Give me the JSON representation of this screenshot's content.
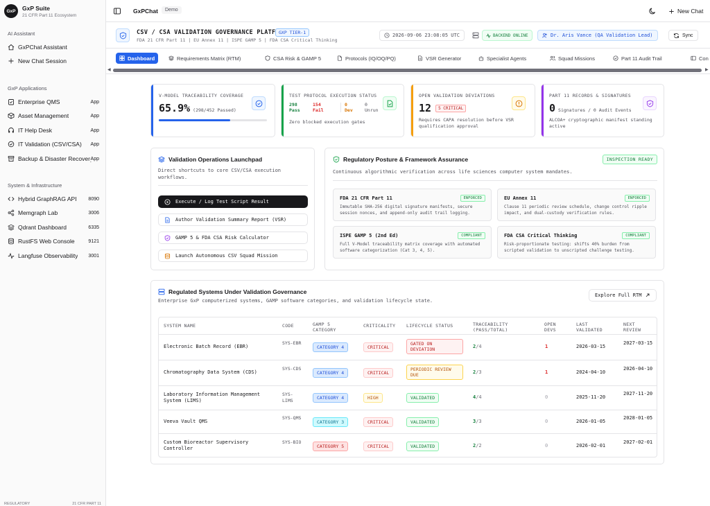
{
  "sidebar": {
    "brand": {
      "logo": "GxP",
      "name": "GxP Suite",
      "subtitle": "21 CFR Part 11 Ecosystem"
    },
    "sections": {
      "ai": "AI Assistant",
      "apps": "GxP Applications",
      "infra": "System & Infrastructure"
    },
    "ai_items": [
      {
        "label": "GxPChat Assistant",
        "icon": "chat-bubble-icon"
      },
      {
        "label": "New Chat Session",
        "icon": "plus-icon"
      }
    ],
    "app_items": [
      {
        "label": "Enterprise QMS",
        "badge": "App"
      },
      {
        "label": "Asset Management",
        "badge": "App"
      },
      {
        "label": "IT Help Desk",
        "badge": "App"
      },
      {
        "label": "IT Validation (CSV/CSA)",
        "badge": "App"
      },
      {
        "label": "Backup & Disaster Recovery",
        "badge": "App"
      }
    ],
    "infra_items": [
      {
        "label": "Hybrid GraphRAG API",
        "badge": "8090"
      },
      {
        "label": "Memgraph Lab",
        "badge": "3006"
      },
      {
        "label": "Qdrant Dashboard",
        "badge": "6335"
      },
      {
        "label": "RustFS Web Console",
        "badge": "9121"
      },
      {
        "label": "Langfuse Observability",
        "badge": "3001"
      }
    ],
    "footer": {
      "left": "REGULATORY",
      "right": "21 CFR PART 11"
    }
  },
  "topbar": {
    "title": "GxPChat",
    "demo": "Demo",
    "new_chat": "New Chat"
  },
  "header": {
    "title": "CSV / CSA VALIDATION GOVERNANCE PLATFORM",
    "tier": "GXP TIER-1",
    "subtitle": "FDA 21 CFR Part 11 | EU Annex 11 | ISPE GAMP 5 | FDA CSA Critical Thinking",
    "timestamp": "2026-09-06 23:08:05 UTC",
    "backend": "BACKEND ONLINE",
    "user": "Dr. Aris Vance (QA Validation Lead)",
    "sync": "Sync"
  },
  "tabs": [
    "Dashboard",
    "Requirements Matrix (RTM)",
    "CSA Risk & GAMP 5",
    "Protocols (IQ/OQ/PQ)",
    "VSR Generator",
    "Specialist Agents",
    "Squad Missions",
    "Part 11 Audit Trail",
    "Con"
  ],
  "kpis": {
    "trace": {
      "title": "V-MODEL TRACEABILITY COVERAGE",
      "value": "65.9%",
      "detail": "(298/452 Passed)",
      "progress": 0.659
    },
    "exec": {
      "title": "TEST PROTOCOL EXECUTION STATUS",
      "pass_n": "298",
      "pass_l": "Pass",
      "fail_n": "154",
      "fail_l": "Fail",
      "dev_n": "0",
      "dev_l": "Dev",
      "unrun_n": "0",
      "unrun_l": "Unrun",
      "note": "Zero blocked execution gates"
    },
    "dev": {
      "title": "OPEN VALIDATION DEVIATIONS",
      "value": "12",
      "badge": "5 CRITICAL",
      "note": "Requires CAPA resolution before VSR qualification approval"
    },
    "part11": {
      "title": "PART 11 RECORDS & SIGNATURES",
      "value": "0",
      "detail": "Signatures / 0 Audit Events",
      "note": "ALCOA+ cryptographic manifest standing active"
    }
  },
  "launchpad": {
    "title": "Validation Operations Launchpad",
    "subtitle": "Direct shortcuts to core CSV/CSA execution workflows.",
    "buttons": [
      "Execute / Log Test Script Result",
      "Author Validation Summary Report (VSR)",
      "GAMP 5 & FDA CSA Risk Calculator",
      "Launch Autonomous CSV Squad Mission"
    ]
  },
  "posture": {
    "title": "Regulatory Posture & Framework Assurance",
    "badge": "INSPECTION READY",
    "subtitle": "Continuous algorithmic verification across life sciences computer system mandates.",
    "frameworks": [
      {
        "name": "FDA 21 CFR Part 11",
        "tag": "ENFORCED",
        "desc": "Immutable SHA-256 digital signature manifests, secure session nonces, and append-only audit trail logging."
      },
      {
        "name": "EU Annex 11",
        "tag": "ENFORCED",
        "desc": "Clause 11 periodic review schedule, change control ripple impact, and dual-custody verification rules."
      },
      {
        "name": "ISPE GAMP 5 (2nd Ed)",
        "tag": "COMPLIANT",
        "desc": "Full V-Model traceability matrix coverage with automated software categorization (Cat 3, 4, 5)."
      },
      {
        "name": "FDA CSA Critical Thinking",
        "tag": "COMPLIANT",
        "desc": "Risk-proportionate testing: shifts 40% burden from scripted validation to unscripted challenge testing."
      }
    ]
  },
  "systems": {
    "title": "Regulated Systems Under Validation Governance",
    "subtitle": "Enterprise GxP computerized systems, GAMP software categories, and validation lifecycle state.",
    "explore": "Explore Full RTM",
    "headers": [
      "SYSTEM NAME",
      "CODE",
      "GAMP 5 CATEGORY",
      "CRITICALITY",
      "LIFECYCLE STATUS",
      "TRACEABILITY (PASS/TOTAL)",
      "OPEN DEVS",
      "LAST VALIDATED",
      "NEXT REVIEW"
    ],
    "rows": [
      {
        "name": "Electronic Batch Record (EBR)",
        "code": "SYS-EBR",
        "cat": "CATEGORY 4",
        "crit": "CRITICAL",
        "status": "GATED ON DEVIATION",
        "pass": "2",
        "total": "/4",
        "devs": "1",
        "last": "2026-03-15",
        "next": "2027-03-15"
      },
      {
        "name": "Chromatography Data System (CDS)",
        "code": "SYS-CDS",
        "cat": "CATEGORY 4",
        "crit": "CRITICAL",
        "status": "PERIODIC REVIEW DUE",
        "pass": "2",
        "total": "/3",
        "devs": "1",
        "last": "2024-04-10",
        "next": "2026-04-10"
      },
      {
        "name": "Laboratory Information Management System (LIMS)",
        "code": "SYS-LIMS",
        "cat": "CATEGORY 4",
        "crit": "HIGH",
        "status": "VALIDATED",
        "pass": "4",
        "total": "/4",
        "devs": "0",
        "last": "2025-11-20",
        "next": "2027-11-20"
      },
      {
        "name": "Veeva Vault QMS",
        "code": "SYS-QMS",
        "cat": "CATEGORY 3",
        "crit": "CRITICAL",
        "status": "VALIDATED",
        "pass": "3",
        "total": "/3",
        "devs": "0",
        "last": "2026-01-05",
        "next": "2028-01-05"
      },
      {
        "name": "Custom Bioreactor Supervisory Controller",
        "code": "SYS-BIO",
        "cat": "CATEGORY 5",
        "crit": "CRITICAL",
        "status": "VALIDATED",
        "pass": "2",
        "total": "/2",
        "devs": "0",
        "last": "2026-02-01",
        "next": "2027-02-01"
      }
    ]
  },
  "colors": {
    "accent": "#2563eb",
    "success": "#16a34a",
    "danger": "#dc2626",
    "warning": "#d97706",
    "purple": "#9333ea"
  }
}
